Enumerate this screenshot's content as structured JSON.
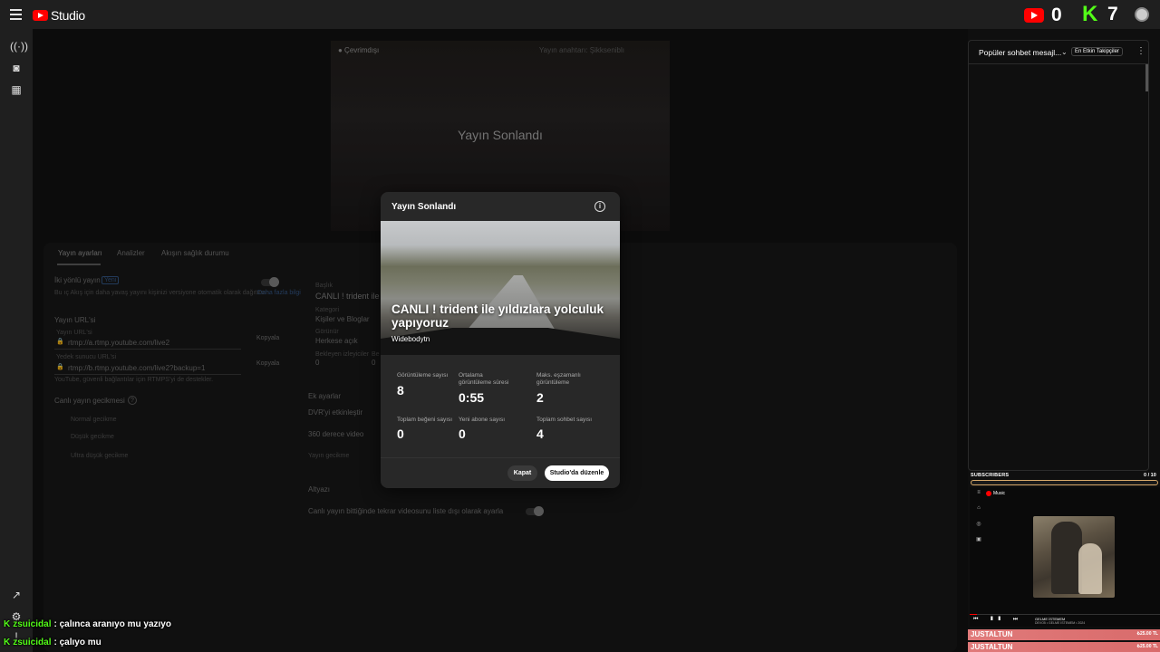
{
  "topbar": {
    "logo_text": "Studio",
    "youtube_count": "0",
    "kick_count": "7"
  },
  "preview": {
    "status": "● Çevrimdışı",
    "ended_title": "Yayın Sonlandı",
    "top_right": "Yayın anahtarı: Şikkseniblı"
  },
  "tabs": {
    "tab1": "Yayın ayarları",
    "tab2": "Analizler",
    "tab3": "Akışın sağlık durumu"
  },
  "settings": {
    "two_way_label": "İki yönlü yayın",
    "new_badge": "Yeni",
    "two_way_desc": "Bu ıç Akış için daha yavaş yayını kişinizi versiyone otomatik olarak dağıtırsın.",
    "more_info": "Daha fazla bilgi",
    "url_title": "Yayın URL'si",
    "rtmp_label": "Yayın URL'si",
    "rtmp_url": "rtmp://a.rtmp.youtube.com/live2",
    "rtmp_copy": "Kopyala",
    "backup_label": "Yedek sunucu URL'si",
    "backup_url": "rtmp://b.rtmp.youtube.com/live2?backup=1",
    "backup_copy": "Kopyala",
    "rtmps_note": "YouTube, güvenli bağlantılar için RTMPS'yi de destekler.",
    "latency_title": "Canlı yayın gecikmesi",
    "latency_opt1": "Normal gecikme",
    "latency_opt2": "Düşük gecikme",
    "latency_opt3": "Ultra düşük gecikme"
  },
  "details": {
    "title_label": "Başlık",
    "title_value": "CANLI ! trident ile",
    "category_label": "Kategori",
    "category_value": "Kişiler ve Bloglar",
    "visibility_label": "Görünür",
    "visibility_value": "Herkese açık",
    "viewers_label": "Bekleyen izleyiciler",
    "viewers_value": "0",
    "likes_label": "Be",
    "likes_value": "0",
    "extra_title": "Ek ayarlar",
    "dvr": "DVR'yi etkinleştir",
    "vr360": "360 derece video",
    "delay": "Yayın gecikme",
    "subtitles": "Altyazı",
    "unlisted": "Canlı yayın bittiğinde tekrar videosunu liste dışı olarak ayarla"
  },
  "modal": {
    "title": "Yayın Sonlandı",
    "video_title": "CANLI ! trident ile yıldızlara yolculuk yapıyoruz",
    "channel": "Widebodytn",
    "stats": [
      {
        "label": "Görüntüleme sayısı",
        "value": "8"
      },
      {
        "label": "Ortalama görüntüleme süresi",
        "value": "0:55"
      },
      {
        "label": "Maks. eşzamanlı görüntüleme",
        "value": "2"
      },
      {
        "label": "Toplam beğeni sayısı",
        "value": "0"
      },
      {
        "label": "Yeni abone sayısı",
        "value": "0"
      },
      {
        "label": "Toplam sohbet sayısı",
        "value": "4"
      }
    ],
    "close_btn": "Kapat",
    "edit_btn": "Studio'da düzenle"
  },
  "chat": {
    "header_title": "Popüler sohbet mesajl...",
    "top_followers": "En Etkin Takipçiler"
  },
  "subs_goal": {
    "label": "SUBSCRIBERS",
    "count": "0 / 10"
  },
  "music": {
    "logo": "Music",
    "track": "GELME İSTEMEM",
    "artist": "DEVO5 • GELME İSTEMEM • 2024"
  },
  "donations": [
    {
      "name": "JUSTALTUN",
      "amount": "₺25.00 TL"
    },
    {
      "name": "JUSTALTUN",
      "amount": "₺25.00 TL"
    }
  ],
  "overlay_chat": [
    {
      "user": "zsuicidal",
      "message": ": çalınca aranıyo mu yazıyo"
    },
    {
      "user": "zsuicidal",
      "message": ": çalıyo mu"
    }
  ],
  "colors": {
    "youtube_red": "#ff0000",
    "kick_green": "#53fc18",
    "subs_border": "#d7a96a",
    "donation": "#e07a7a"
  }
}
